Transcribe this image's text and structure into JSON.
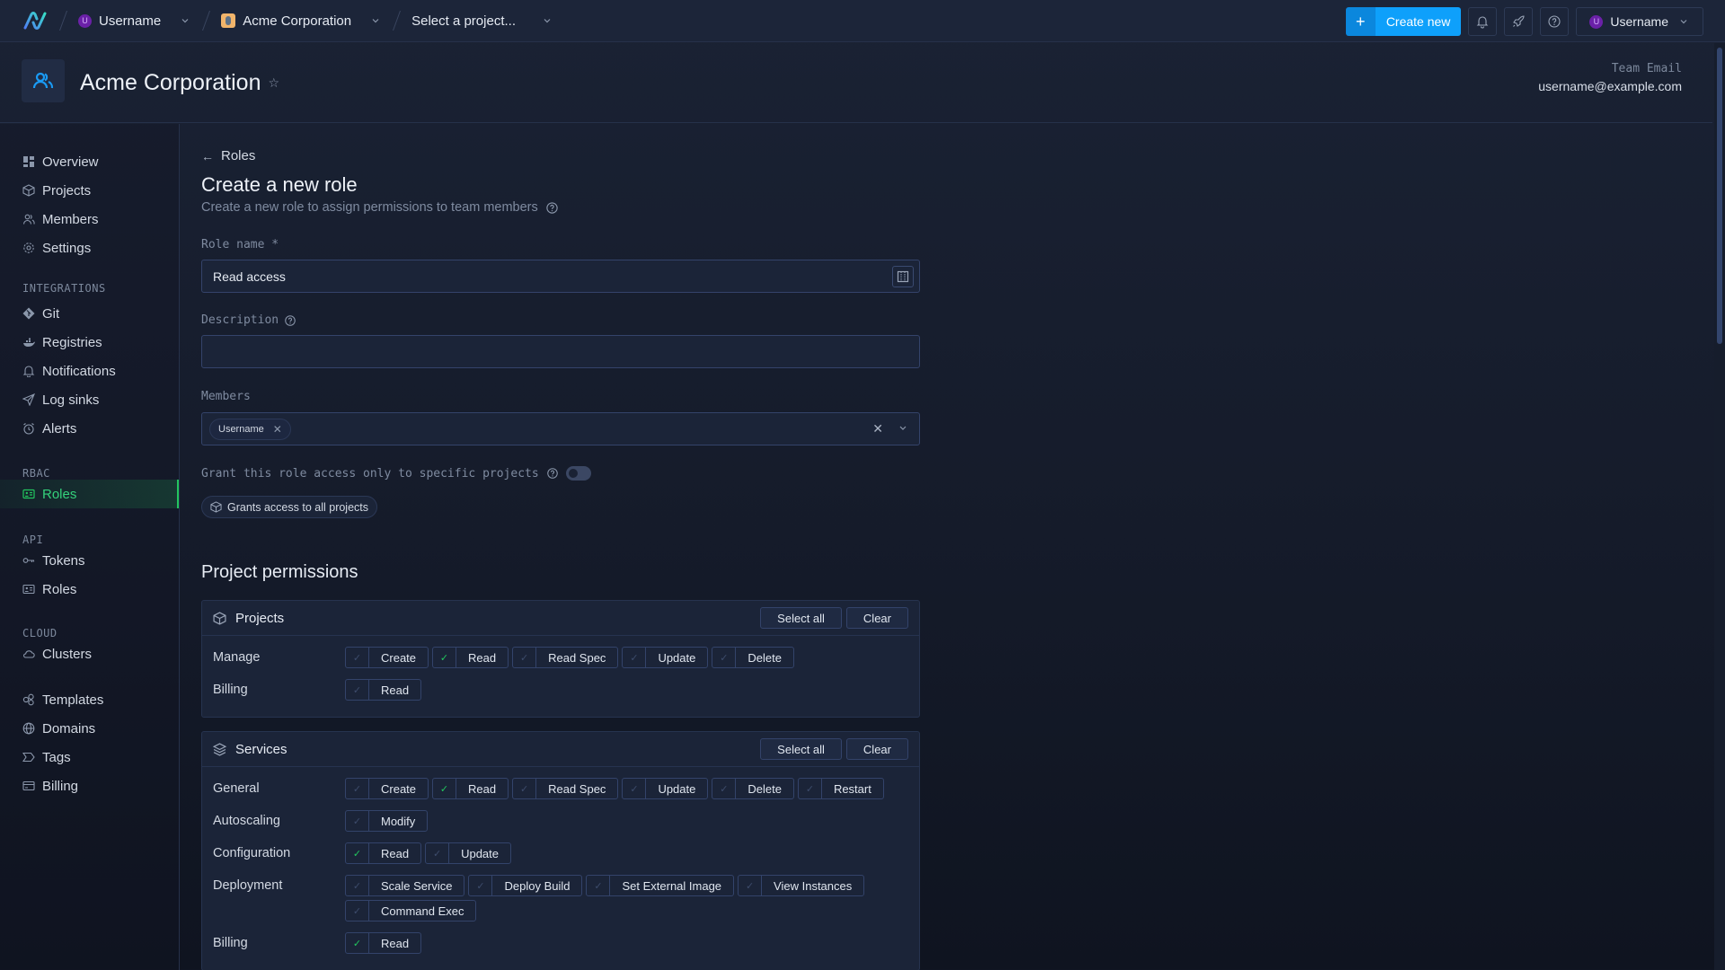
{
  "topbar": {
    "breadcrumbs": [
      {
        "label": "Username",
        "type": "user",
        "avatar_letter": "U"
      },
      {
        "label": "Acme Corporation",
        "type": "organization"
      },
      {
        "label": "Select a project...",
        "type": "project-select"
      }
    ],
    "create_new_label": "Create new",
    "icons": [
      "bell-icon",
      "rocket-icon",
      "help-icon"
    ],
    "user_menu": {
      "label": "Username",
      "avatar_letter": "U"
    }
  },
  "team": {
    "name": "Acme Corporation",
    "email_label": "Team Email",
    "email": "username@example.com"
  },
  "sidebar": {
    "items": [
      {
        "label": "Overview",
        "icon": "grid-icon"
      },
      {
        "label": "Projects",
        "icon": "box-icon"
      },
      {
        "label": "Members",
        "icon": "users-icon"
      },
      {
        "label": "Settings",
        "icon": "gear-icon"
      }
    ],
    "sections": [
      {
        "title": "INTEGRATIONS",
        "items": [
          {
            "label": "Git",
            "icon": "git-icon"
          },
          {
            "label": "Registries",
            "icon": "docker-icon"
          },
          {
            "label": "Notifications",
            "icon": "bell-icon"
          },
          {
            "label": "Log sinks",
            "icon": "send-icon"
          },
          {
            "label": "Alerts",
            "icon": "alarm-icon"
          }
        ]
      },
      {
        "title": "RBAC",
        "items": [
          {
            "label": "Roles",
            "icon": "id-card-icon",
            "active": true
          }
        ]
      },
      {
        "title": "API",
        "items": [
          {
            "label": "Tokens",
            "icon": "key-icon"
          },
          {
            "label": "Roles",
            "icon": "id-card-icon"
          }
        ]
      },
      {
        "title": "CLOUD",
        "items": [
          {
            "label": "Clusters",
            "icon": "cloud-icon"
          }
        ]
      },
      {
        "title": "",
        "items": [
          {
            "label": "Templates",
            "icon": "templates-icon"
          },
          {
            "label": "Domains",
            "icon": "globe-icon"
          },
          {
            "label": "Tags",
            "icon": "tag-icon"
          },
          {
            "label": "Billing",
            "icon": "credit-card-icon"
          }
        ]
      }
    ]
  },
  "form": {
    "back_label": "Roles",
    "title": "Create a new role",
    "subtitle": "Create a new role to assign permissions to team members",
    "role_name_label": "Role name *",
    "role_name_value": "Read access",
    "description_label": "Description",
    "description_value": "",
    "members_label": "Members",
    "members": [
      "Username"
    ],
    "specific_projects_label": "Grant this role access only to specific projects",
    "specific_projects_enabled": false,
    "all_projects_pill": "Grants access to all projects"
  },
  "permissions": {
    "section_title": "Project permissions",
    "select_all_label": "Select all",
    "clear_label": "Clear",
    "groups": [
      {
        "name": "Projects",
        "icon": "box-icon",
        "rows": [
          {
            "label": "Manage",
            "perms": [
              {
                "label": "Create",
                "checked": false
              },
              {
                "label": "Read",
                "checked": true
              },
              {
                "label": "Read Spec",
                "checked": false
              },
              {
                "label": "Update",
                "checked": false
              },
              {
                "label": "Delete",
                "checked": false
              }
            ]
          },
          {
            "label": "Billing",
            "perms": [
              {
                "label": "Read",
                "checked": false
              }
            ]
          }
        ]
      },
      {
        "name": "Services",
        "icon": "layers-icon",
        "rows": [
          {
            "label": "General",
            "perms": [
              {
                "label": "Create",
                "checked": false
              },
              {
                "label": "Read",
                "checked": true
              },
              {
                "label": "Read Spec",
                "checked": false
              },
              {
                "label": "Update",
                "checked": false
              },
              {
                "label": "Delete",
                "checked": false
              },
              {
                "label": "Restart",
                "checked": false
              }
            ]
          },
          {
            "label": "Autoscaling",
            "perms": [
              {
                "label": "Modify",
                "checked": false
              }
            ]
          },
          {
            "label": "Configuration",
            "perms": [
              {
                "label": "Read",
                "checked": true
              },
              {
                "label": "Update",
                "checked": false
              }
            ]
          },
          {
            "label": "Deployment",
            "perms": [
              {
                "label": "Scale Service",
                "checked": false
              },
              {
                "label": "Deploy Build",
                "checked": false
              },
              {
                "label": "Set External Image",
                "checked": false
              },
              {
                "label": "View Instances",
                "checked": false
              },
              {
                "label": "Command Exec",
                "checked": false
              }
            ]
          },
          {
            "label": "Billing",
            "perms": [
              {
                "label": "Read",
                "checked": true
              }
            ]
          }
        ]
      }
    ]
  },
  "colors": {
    "accent": "#0ea0fb",
    "active_nav": "#22c55e",
    "background": "#1a2234"
  }
}
